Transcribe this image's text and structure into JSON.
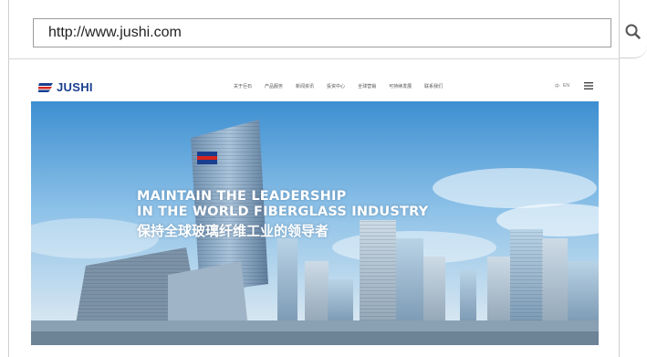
{
  "browser": {
    "address_bar": {
      "url": "http://www.jushi.com"
    },
    "search_icon": "search-icon"
  },
  "site": {
    "logo_text": "JUSHI",
    "nav_items": [
      "关于巨石",
      "产品服务",
      "新闻资讯",
      "投资中心",
      "全球营销",
      "可持续发展",
      "联系我们"
    ],
    "languages": [
      "中",
      "EN"
    ],
    "menu_icon": "menu-icon"
  },
  "hero": {
    "line1": "MAINTAIN THE LEADERSHIP",
    "line2": "IN THE WORLD FIBERGLASS INDUSTRY",
    "line3": "保持全球玻璃纤维工业的领导者"
  },
  "colors": {
    "brand_blue": "#1a3f8f",
    "brand_red": "#d9241c",
    "sky_top": "#3d8fd1",
    "sky_bottom": "#e6eef3"
  }
}
